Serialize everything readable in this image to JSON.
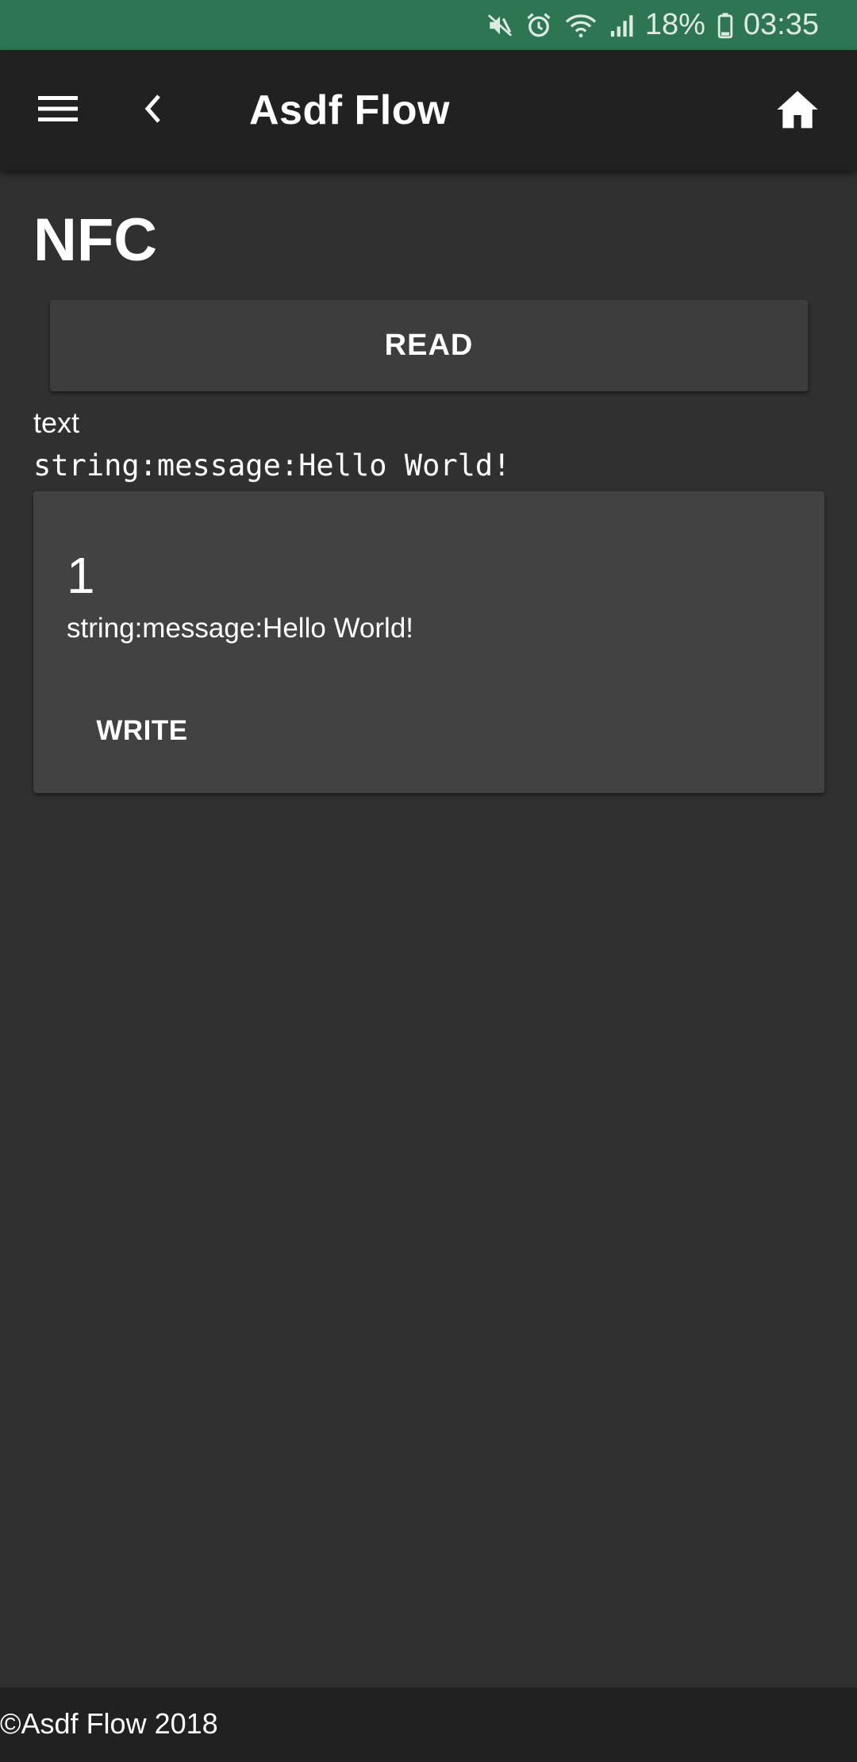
{
  "status_bar": {
    "battery_percent": "18%",
    "time": "03:35",
    "icons": [
      "mute-icon",
      "alarm-icon",
      "wifi-icon",
      "signal-icon",
      "battery-icon"
    ],
    "background_color": "#2e7651"
  },
  "app_bar": {
    "title": "Asdf Flow",
    "menu_icon": "hamburger-menu-icon",
    "back_icon": "chevron-left-icon",
    "home_icon": "home-icon",
    "background_color": "#212121"
  },
  "main": {
    "page_title": "NFC",
    "read_button_label": "READ",
    "record_type": "text",
    "record_payload": "string:message:Hello World!",
    "card": {
      "number": "1",
      "subtitle": "string:message:Hello World!",
      "write_button_label": "WRITE"
    },
    "background_color": "#303030"
  },
  "footer": {
    "text": "©Asdf Flow 2018"
  }
}
